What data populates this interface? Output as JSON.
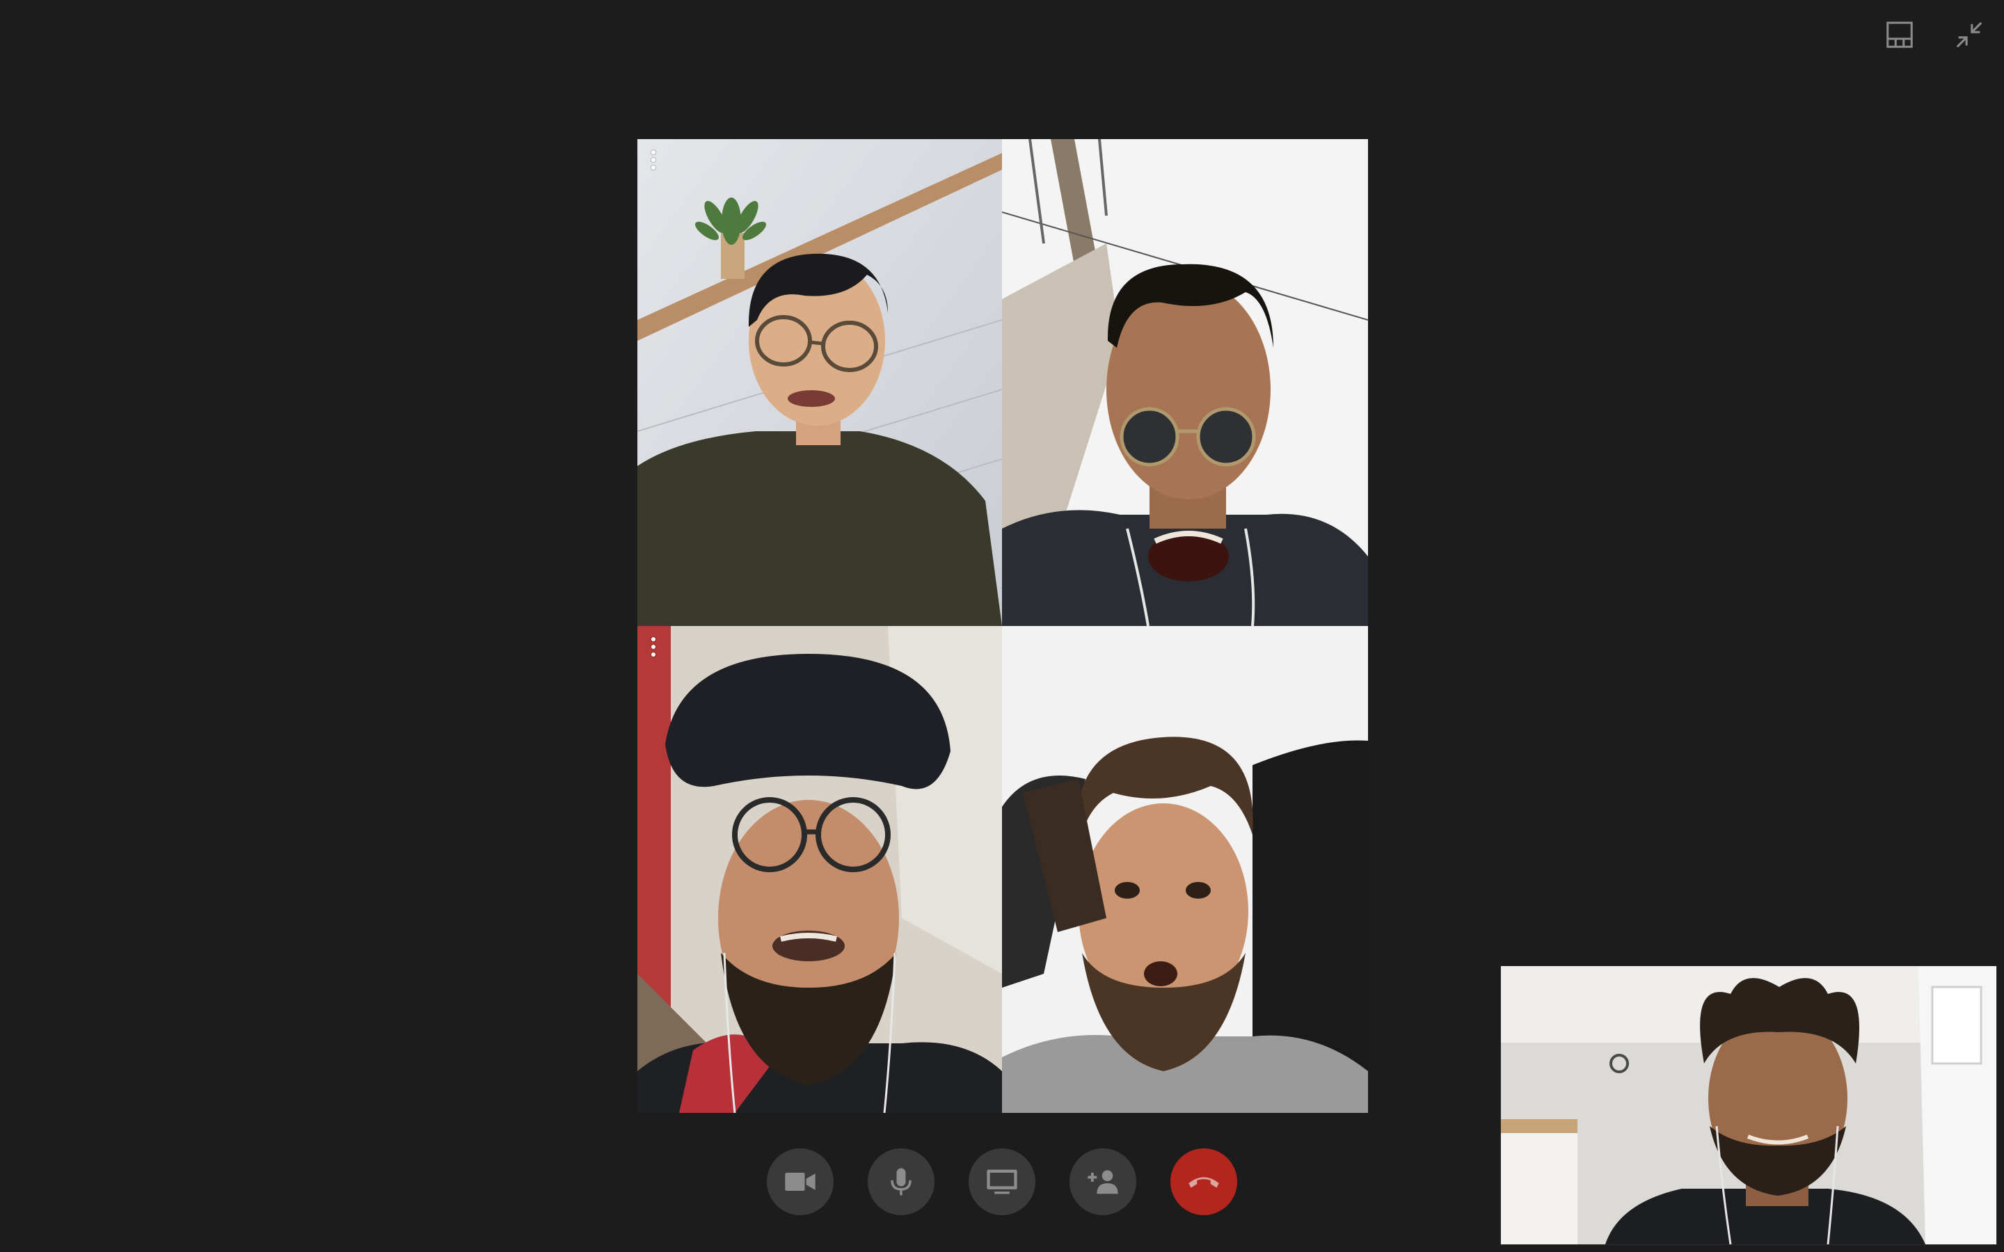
{
  "window": {
    "background": "#1c1c1c"
  },
  "top_controls": {
    "layout_icon": "layout-grid-icon",
    "exit_fullscreen_icon": "exit-fullscreen-icon"
  },
  "participants": [
    {
      "menu_icon": "more-vertical-icon",
      "show_menu": true
    },
    {
      "menu_icon": "more-vertical-icon",
      "show_menu": false
    },
    {
      "menu_icon": "more-vertical-icon",
      "show_menu": true
    },
    {
      "menu_icon": "more-vertical-icon",
      "show_menu": false
    }
  ],
  "self_view": {
    "icon": "self-camera-preview"
  },
  "call_controls": {
    "buttons": [
      {
        "icon": "video-camera-icon",
        "color": "#3a3a3a"
      },
      {
        "icon": "microphone-icon",
        "color": "#3a3a3a"
      },
      {
        "icon": "screen-share-icon",
        "color": "#3a3a3a"
      },
      {
        "icon": "add-person-icon",
        "color": "#3a3a3a"
      },
      {
        "icon": "hang-up-icon",
        "color": "#b3261e"
      }
    ]
  }
}
